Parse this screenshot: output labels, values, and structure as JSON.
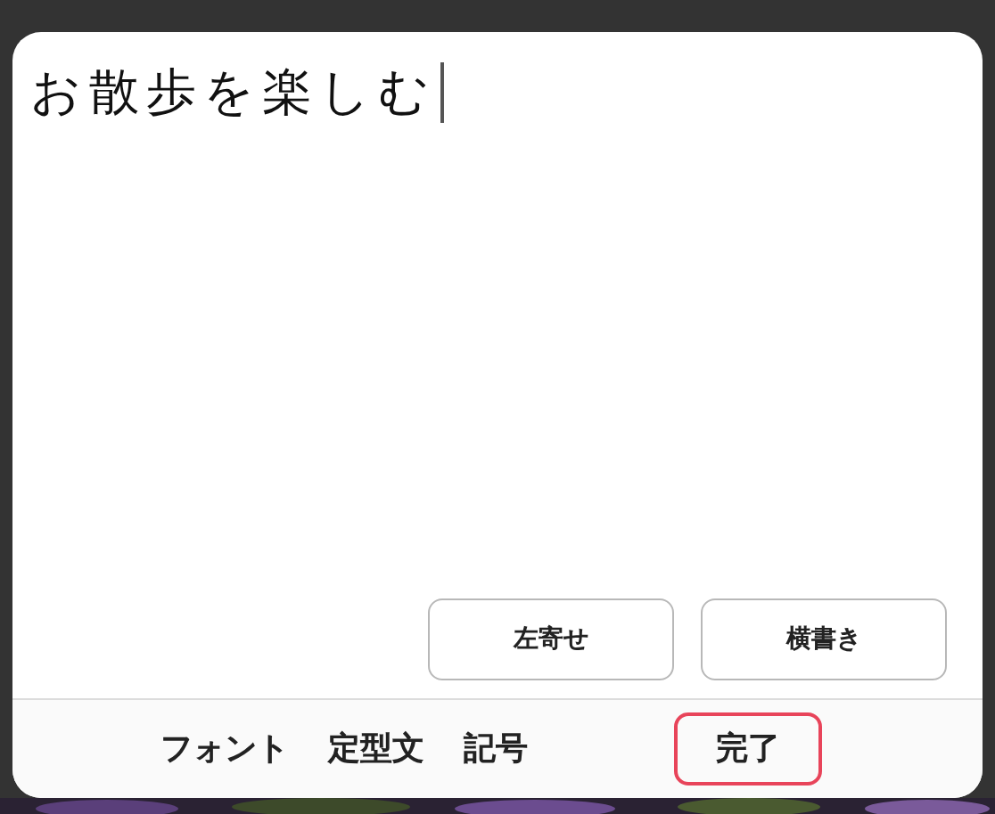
{
  "editor": {
    "value": "お散歩を楽しむ"
  },
  "option_buttons": [
    "左寄せ",
    "横書き"
  ],
  "toolbar": [
    {
      "label": "フォント",
      "kind": "tab"
    },
    {
      "label": "定型文",
      "kind": "tab"
    },
    {
      "label": "記号",
      "kind": "tab"
    },
    {
      "label": "完了",
      "kind": "done"
    }
  ]
}
